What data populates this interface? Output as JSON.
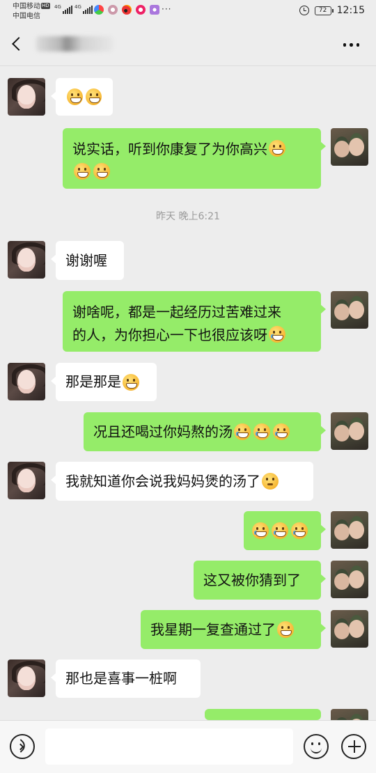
{
  "status_bar": {
    "carrier_1": "中国移动",
    "carrier_1_badge": "HD",
    "carrier_2": "中国电信",
    "network_1": "4G",
    "network_2": "4G",
    "overflow": "···",
    "battery": "72",
    "time": "12:15",
    "app_icons": [
      "app-icon-1",
      "app-icon-2",
      "weibo-icon",
      "app-icon-4",
      "app-icon-5"
    ]
  },
  "header": {
    "contact_name": "",
    "back_icon": "chevron-left-icon",
    "more_icon": "more-dots-icon"
  },
  "messages": [
    {
      "side": "in",
      "text": "",
      "emojis": [
        "grin-emoji",
        "grin-emoji"
      ]
    },
    {
      "side": "out",
      "line1": "说实话，听到你康复了为你高兴",
      "emojis_line1": [
        "grin-emoji"
      ],
      "emojis_line2": [
        "grin-emoji",
        "grin-emoji"
      ]
    },
    {
      "side": "in",
      "text": "谢谢喔"
    },
    {
      "side": "out",
      "line1": "谢啥呢，都是一起经历过苦难过来",
      "line2": "的人，为你担心一下也很应该呀",
      "emojis_line2": [
        "cry-laugh-emoji"
      ]
    },
    {
      "side": "in",
      "text": "那是那是",
      "emojis": [
        "grimace-emoji"
      ]
    },
    {
      "side": "out",
      "text": "况且还喝过你妈熬的汤",
      "emojis": [
        "cry-laugh-emoji",
        "cry-laugh-emoji",
        "cry-laugh-emoji"
      ]
    },
    {
      "side": "in",
      "text": "我就知道你会说我妈妈煲的汤了",
      "emojis": [
        "thinking-emoji"
      ]
    },
    {
      "side": "out",
      "text": "",
      "emojis": [
        "cry-laugh-emoji",
        "cry-laugh-emoji",
        "cry-laugh-emoji"
      ]
    },
    {
      "side": "out",
      "text": "这又被你猜到了"
    },
    {
      "side": "out",
      "text": "我星期一复查通过了",
      "emojis": [
        "smirk-emoji"
      ]
    },
    {
      "side": "in",
      "text": "那也是喜事一桩啊"
    },
    {
      "side": "out",
      "text": ""
    }
  ],
  "timestamp": "昨天 晚上6:21",
  "input_bar": {
    "voice_icon": "voice-icon",
    "text_value": "",
    "emoji_icon": "emoji-icon",
    "plus_icon": "plus-icon"
  },
  "colors": {
    "background": "#ededed",
    "outgoing_bubble": "#95ec69",
    "incoming_bubble": "#ffffff",
    "timestamp_text": "#9a9a9a"
  }
}
